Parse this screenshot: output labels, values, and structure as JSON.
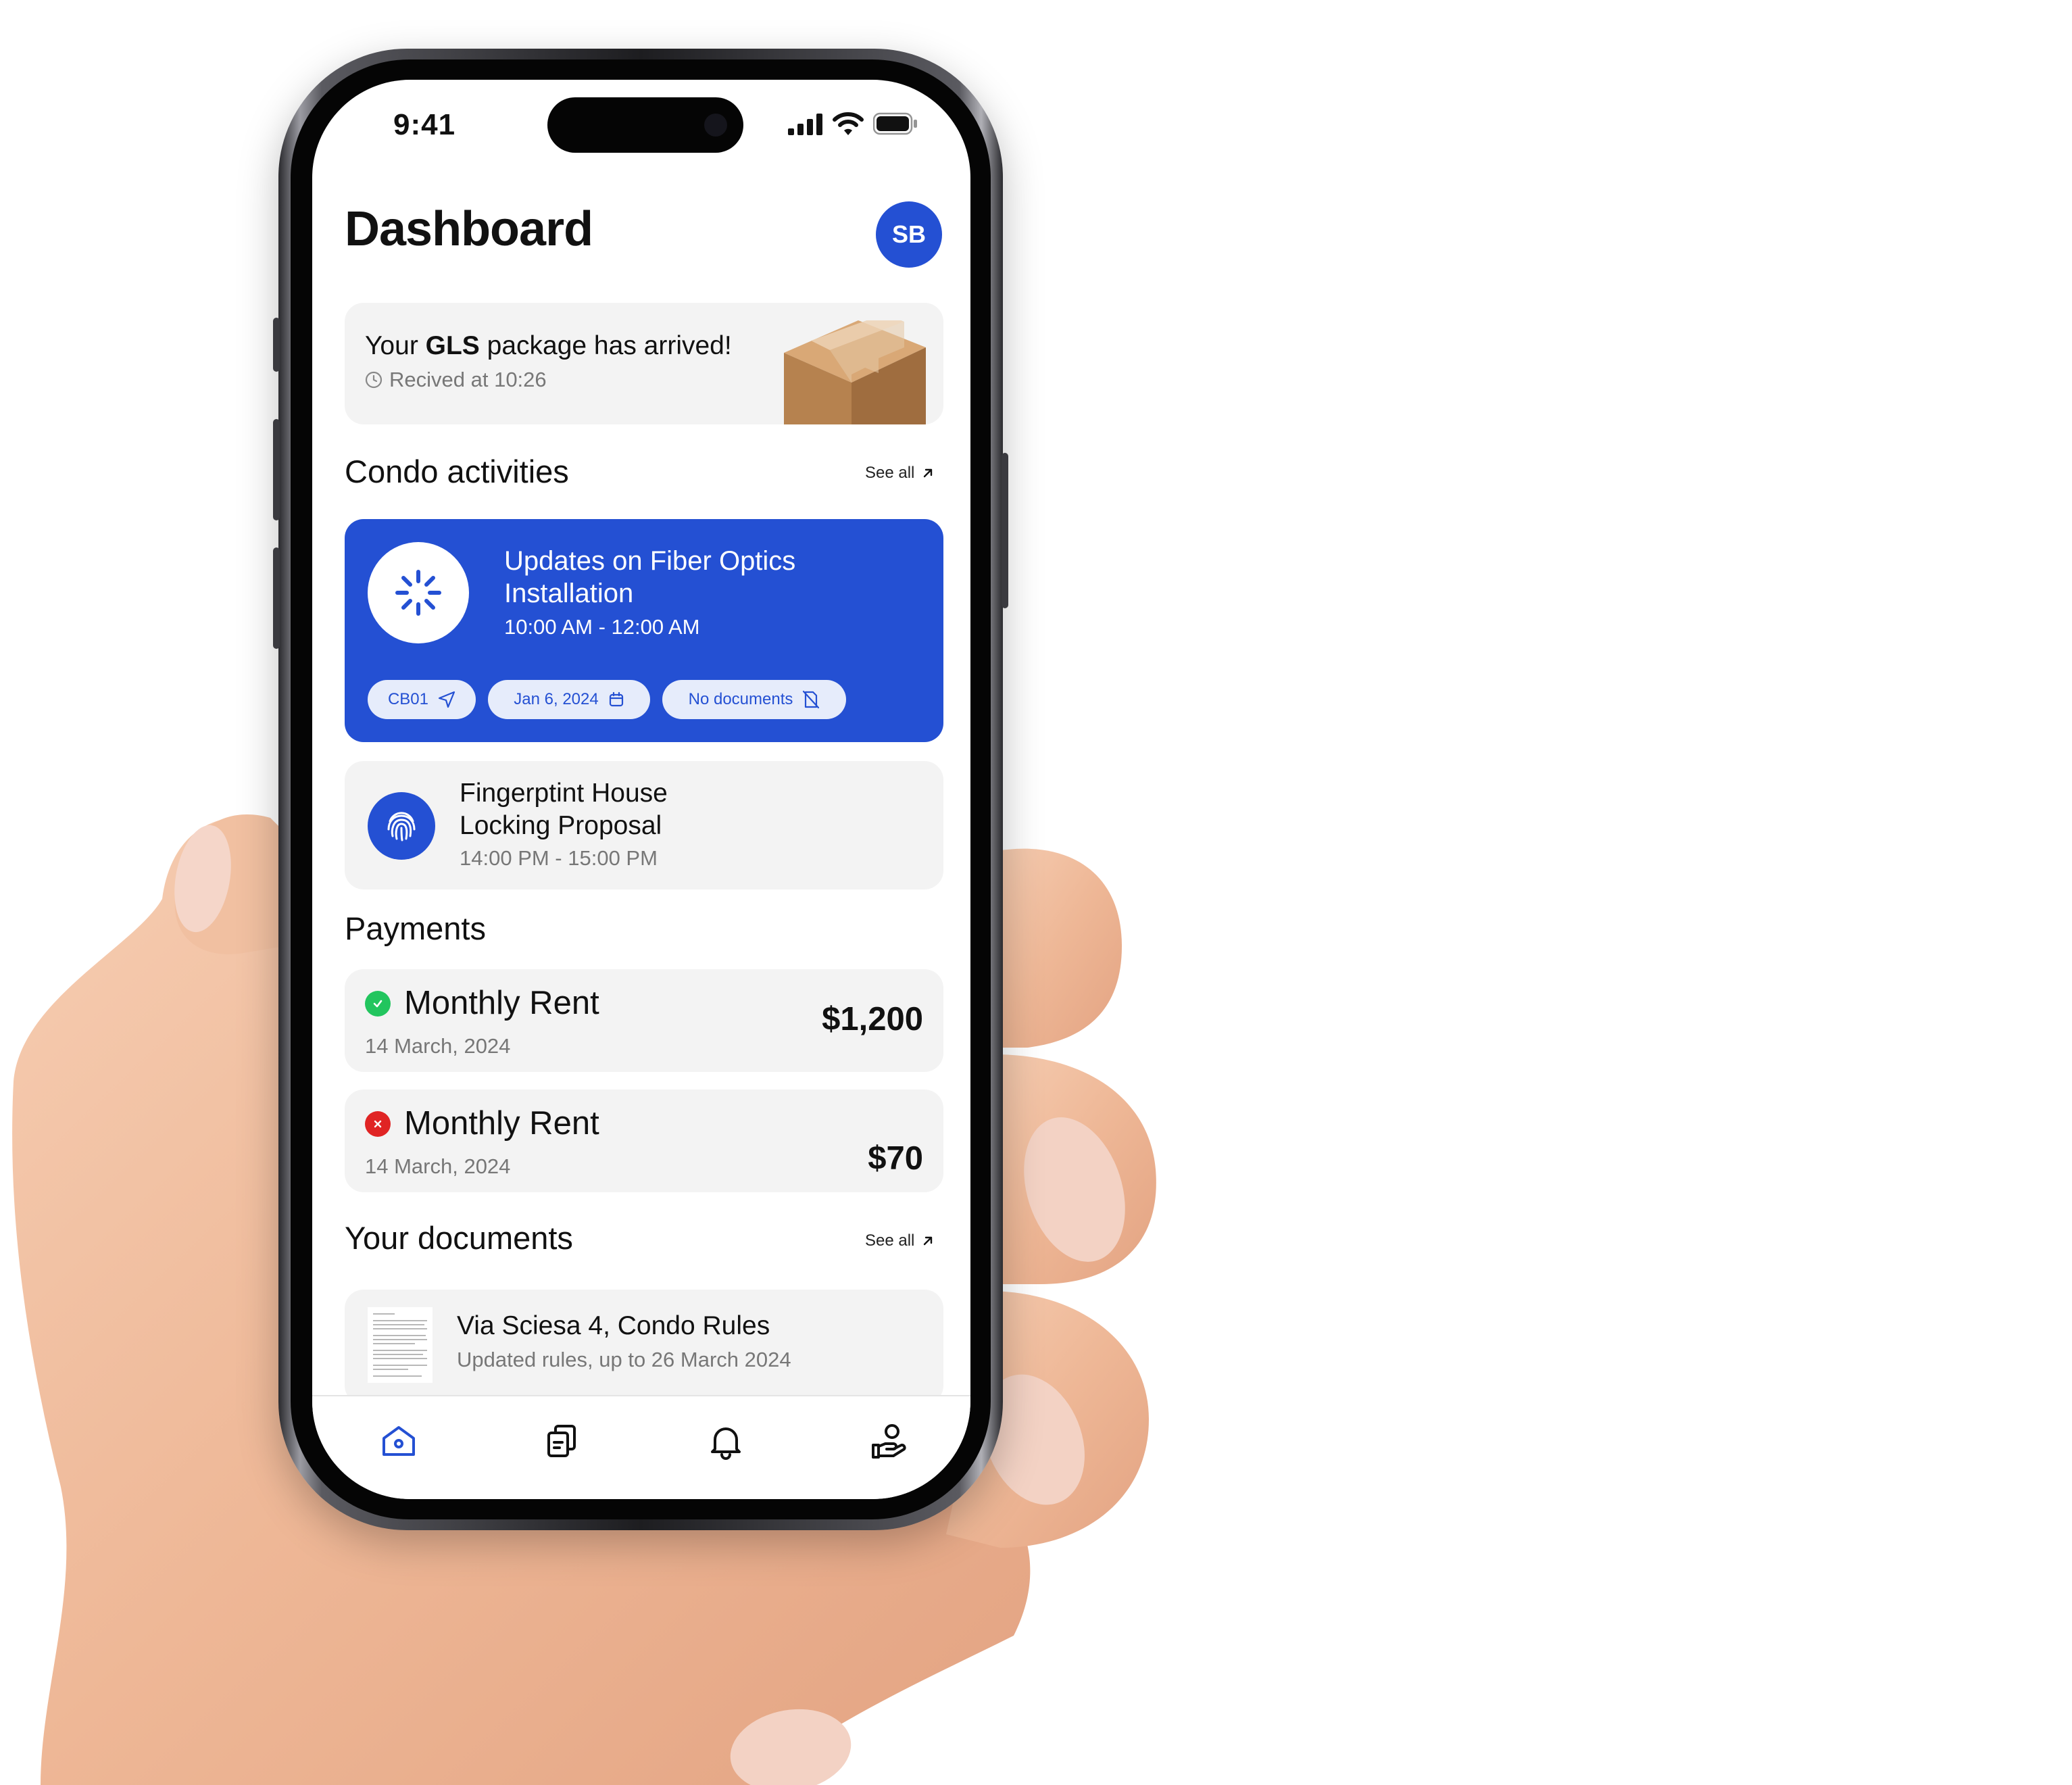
{
  "status_bar": {
    "time": "9:41"
  },
  "header": {
    "title": "Dashboard",
    "avatar_initials": "SB"
  },
  "package_notice": {
    "text_prefix": "Your ",
    "carrier": "GLS",
    "text_suffix": " package has arrived!",
    "received": "Recived at 10:26"
  },
  "condo_activities": {
    "title": "Condo activities",
    "see_all": "See all",
    "items": [
      {
        "title": "Updates on Fiber Optics Installation",
        "time": "10:00 AM - 12:00 AM",
        "chips": {
          "unit": "CB01",
          "date": "Jan 6, 2024",
          "documents": "No documents"
        }
      },
      {
        "title_line1": "Fingerptint House",
        "title_line2": "Locking Proposal",
        "time": "14:00 PM - 15:00 PM"
      }
    ]
  },
  "payments": {
    "title": "Payments",
    "items": [
      {
        "title": "Monthly Rent",
        "date": "14 March, 2024",
        "amount": "$1,200",
        "status": "paid"
      },
      {
        "title": "Monthly Rent",
        "date": "14 March, 2024",
        "amount": "$70",
        "status": "unpaid"
      }
    ]
  },
  "documents": {
    "title": "Your documents",
    "see_all": "See all",
    "items": [
      {
        "title": "Via Sciesa 4, Condo Rules",
        "subtitle": "Updated rules, up to 26 March 2024"
      }
    ]
  },
  "bottom_nav": {
    "items": [
      {
        "icon": "home-icon",
        "active": true
      },
      {
        "icon": "documents-icon",
        "active": false
      },
      {
        "icon": "bell-icon",
        "active": false
      },
      {
        "icon": "payment-hand-icon",
        "active": false
      }
    ]
  },
  "colors": {
    "accent": "#2450d3",
    "success": "#22c55e",
    "danger": "#e02424",
    "card_bg": "#f3f3f3",
    "muted_text": "#777777"
  }
}
